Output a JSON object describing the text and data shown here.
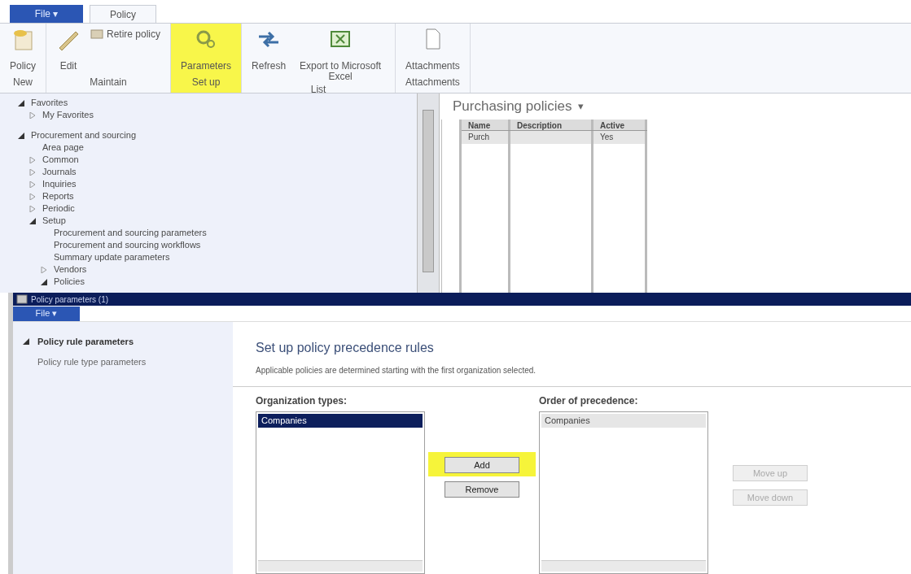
{
  "ribbon": {
    "tabs": [
      {
        "label": "File",
        "glyph": "▾",
        "kind": "file",
        "selected": false
      },
      {
        "label": "Policy",
        "kind": "tab",
        "selected": true
      }
    ],
    "groups": [
      {
        "label": "New",
        "highlighted": false,
        "buttons": [
          {
            "label": "Policy",
            "kind": "large"
          }
        ]
      },
      {
        "label": "Maintain",
        "highlighted": false,
        "buttons": [
          {
            "label": "Edit",
            "kind": "large"
          },
          {
            "label": "Retire policy",
            "kind": "small"
          }
        ]
      },
      {
        "label": "Set up",
        "highlighted": true,
        "buttons": [
          {
            "label": "Parameters",
            "kind": "large"
          }
        ]
      },
      {
        "label": "List",
        "highlighted": false,
        "buttons": [
          {
            "label": "Refresh",
            "kind": "large"
          },
          {
            "label": "Export to Microsoft Excel",
            "kind": "large"
          }
        ]
      },
      {
        "label": "Attachments",
        "highlighted": false,
        "buttons": [
          {
            "label": "Attachments",
            "kind": "large"
          }
        ]
      }
    ]
  },
  "nav_tree": [
    {
      "label": "Favorites",
      "expanded": true,
      "children": [
        {
          "label": "My Favorites",
          "expanded": false
        }
      ]
    },
    {
      "label": "Procurement and sourcing",
      "expanded": true,
      "children": [
        {
          "label": "Area page"
        },
        {
          "label": "Common",
          "expanded": false
        },
        {
          "label": "Journals",
          "expanded": false
        },
        {
          "label": "Inquiries",
          "expanded": false
        },
        {
          "label": "Reports",
          "expanded": false
        },
        {
          "label": "Periodic",
          "expanded": false
        },
        {
          "label": "Setup",
          "expanded": true,
          "children": [
            {
              "label": "Procurement and sourcing parameters"
            },
            {
              "label": "Procurement and sourcing workflows"
            },
            {
              "label": "Summary update parameters"
            },
            {
              "label": "Vendors",
              "expanded": false
            },
            {
              "label": "Policies",
              "expanded": true
            }
          ]
        }
      ]
    }
  ],
  "list_page": {
    "title": "Purchasing policies",
    "menu_glyph": "▾",
    "columns": [
      "Name",
      "Description",
      "Active"
    ],
    "rows": [
      [
        "Purch",
        "",
        "Yes"
      ]
    ]
  },
  "dialog": {
    "title": "Policy parameters (1)",
    "file_tab": "File",
    "file_tab_glyph": "▾",
    "nav": [
      {
        "label": "Policy rule parameters",
        "selected": true
      },
      {
        "label": "Policy rule type parameters",
        "selected": false
      }
    ],
    "heading": "Set up policy precedence rules",
    "description": "Applicable policies are determined starting with the first organization selected.",
    "left_list": {
      "label": "Organization types:",
      "items": [
        {
          "label": "Companies",
          "selected": true
        }
      ]
    },
    "middle_buttons": [
      {
        "label": "Add",
        "highlighted": true,
        "disabled": false
      },
      {
        "label": "Remove",
        "highlighted": false,
        "disabled": false
      }
    ],
    "right_list": {
      "label": "Order of precedence:",
      "items": [
        {
          "label": "Companies",
          "selected": false
        }
      ]
    },
    "right_buttons": [
      {
        "label": "Move up",
        "highlighted": false,
        "disabled": true
      },
      {
        "label": "Move down",
        "highlighted": false,
        "disabled": true
      }
    ]
  }
}
